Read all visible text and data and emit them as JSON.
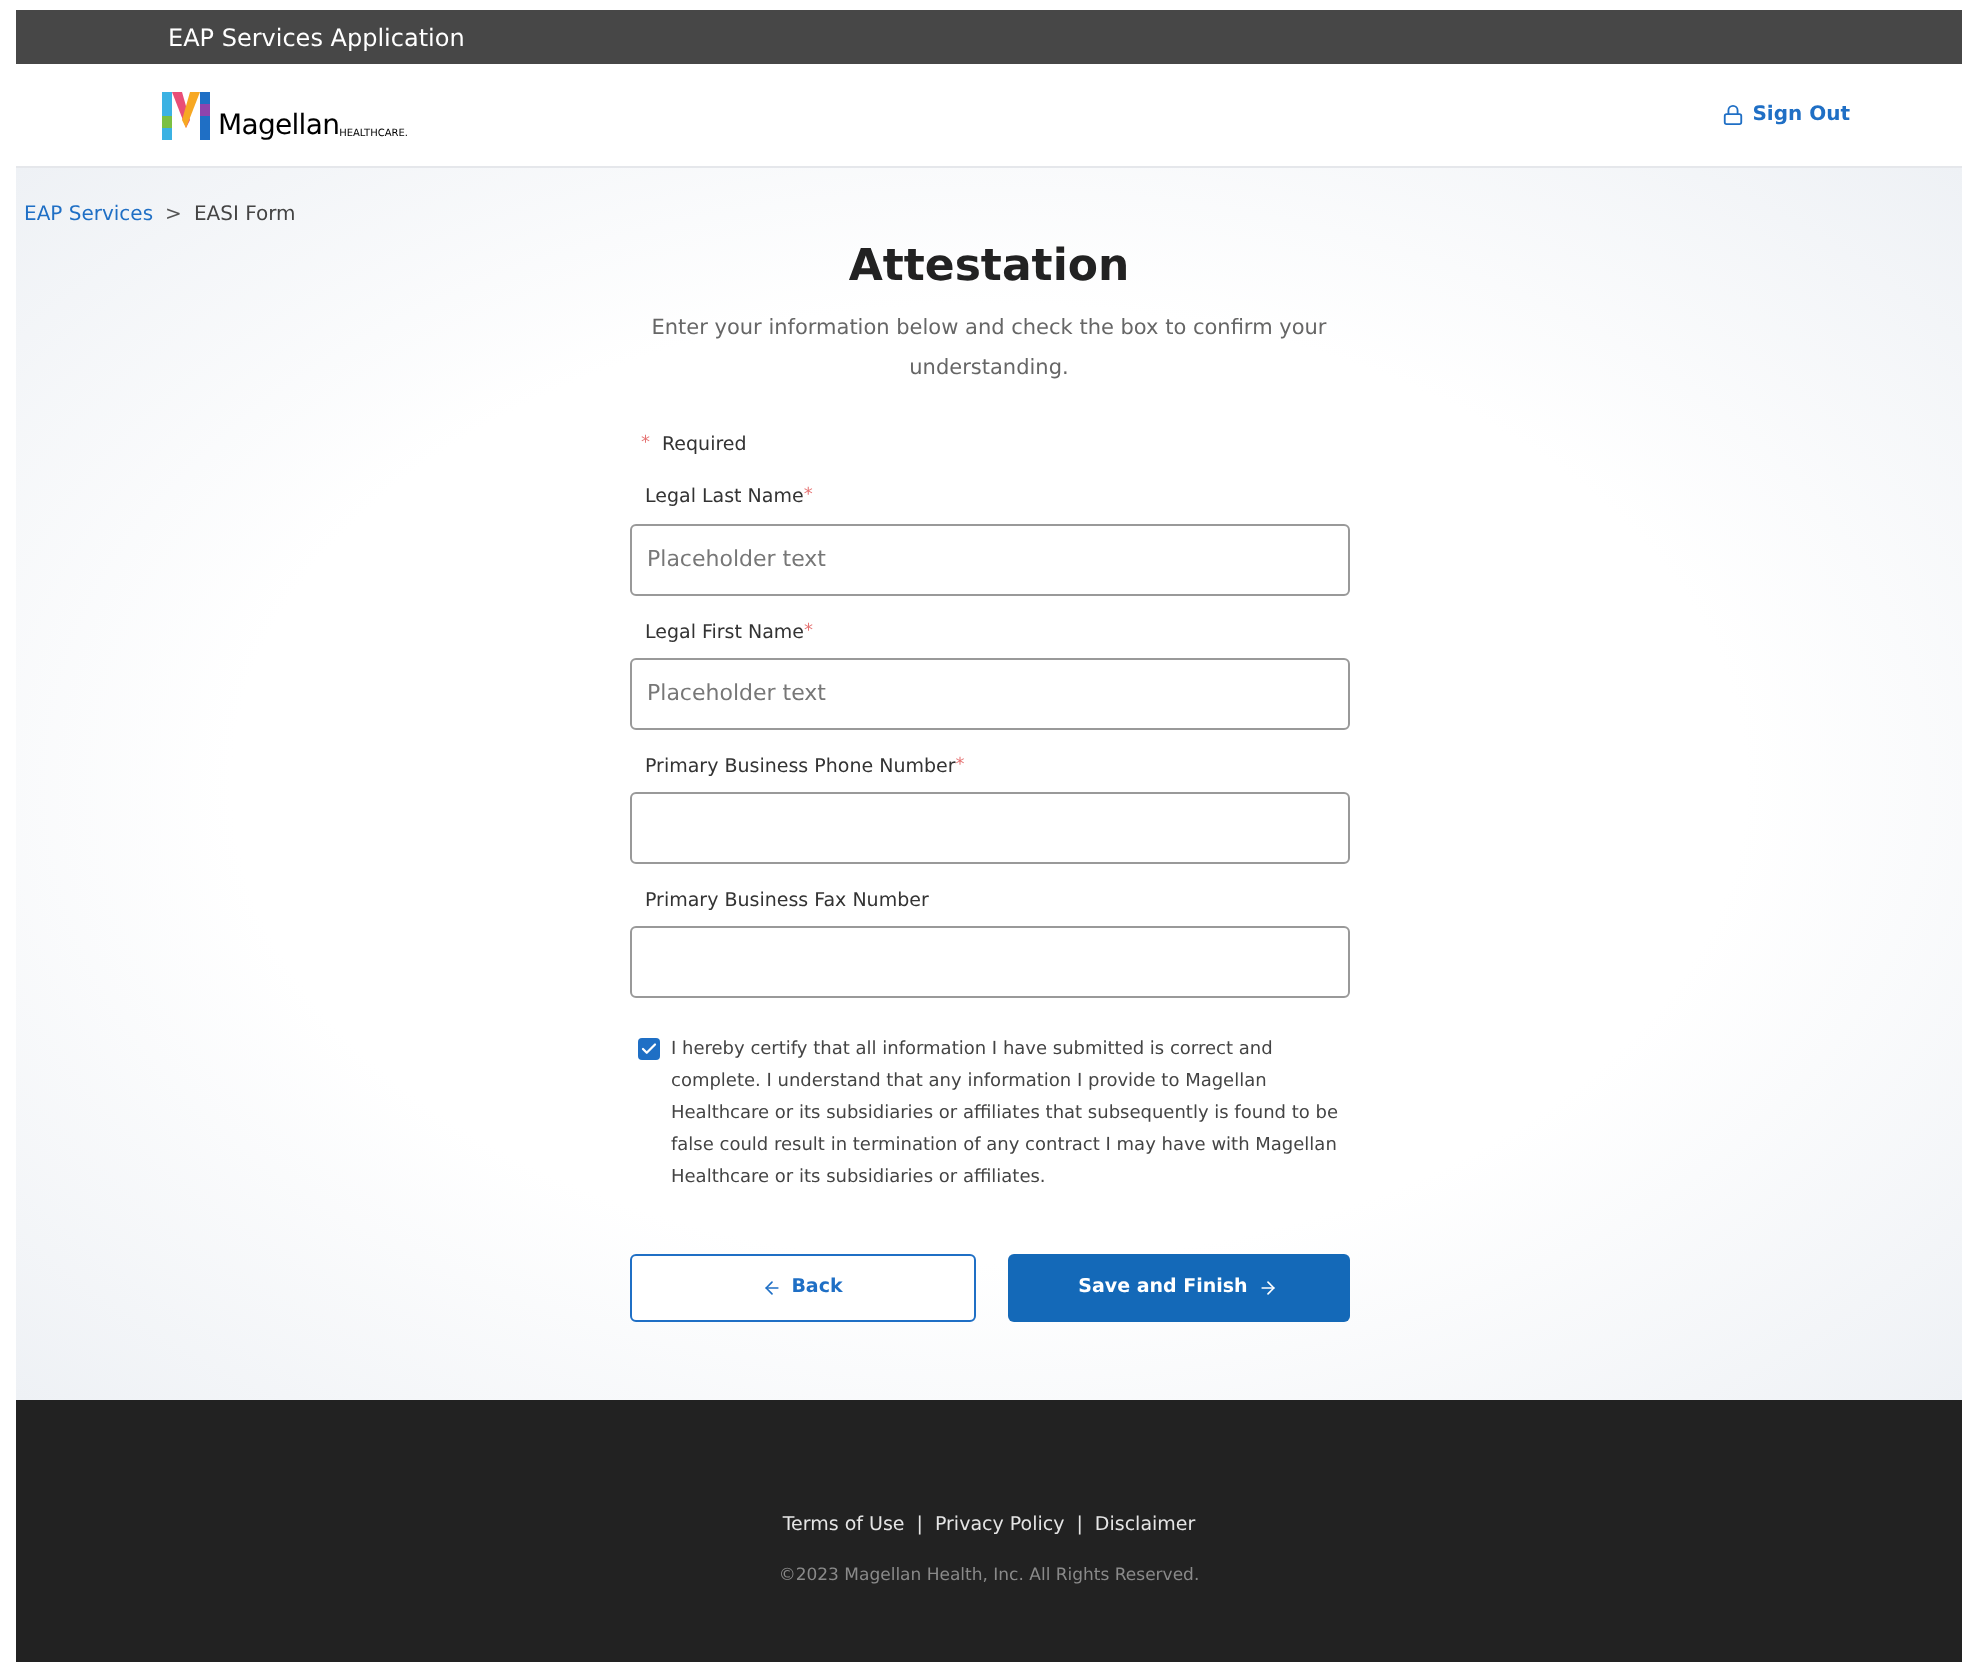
{
  "app_bar": {
    "title": "EAP Services Application"
  },
  "header": {
    "logo": {
      "name": "Magellan",
      "tagline": "HEALTHCARE."
    },
    "sign_out": "Sign Out"
  },
  "breadcrumb": [
    {
      "label": "EAP Services",
      "link": true
    },
    {
      "label": "EASI Form",
      "link": false
    }
  ],
  "breadcrumb_separator": ">",
  "form": {
    "title": "Attestation",
    "subtitle": "Enter your information below and check the box to confirm your understanding.",
    "required_note": {
      "mark": "*",
      "text": "Required"
    },
    "fields": [
      {
        "label": "Legal Last Name",
        "required": true,
        "placeholder": "Placeholder text"
      },
      {
        "label": "Legal First Name",
        "required": true,
        "placeholder": "Placeholder text"
      },
      {
        "label": "Primary Business Phone Number",
        "required": true
      },
      {
        "label": "Primary Business Fax Number",
        "required": false
      }
    ],
    "required_mark": "*",
    "attestation": {
      "checked": true,
      "text": "I hereby certify that all information I have submitted is correct and complete. I understand that any information I provide to Magellan Healthcare or its subsidiaries or affiliates that subsequently is found to be false could result in termination of any contract I may have with Magellan Healthcare or its subsidiaries or affiliates."
    },
    "buttons": [
      {
        "label": "Back",
        "kind": "secondary"
      },
      {
        "label": "Save and Finish",
        "kind": "primary"
      }
    ]
  },
  "footer": {
    "links": [
      "Terms of Use",
      "Privacy Policy",
      "Disclaimer"
    ],
    "separator": "|",
    "copyright": "©2023 Magellan Health, Inc. All Rights Reserved."
  }
}
